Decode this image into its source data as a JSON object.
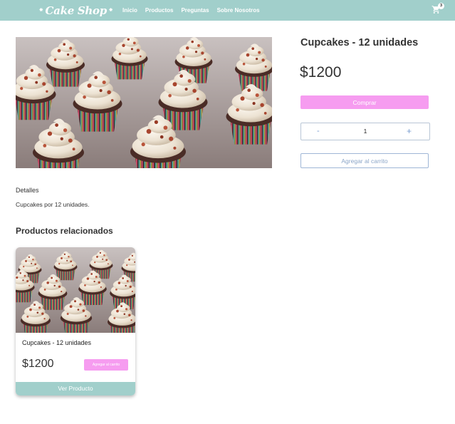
{
  "navbar": {
    "logo_text": "Cake Shop",
    "links": [
      "Inicio",
      "Productos",
      "Preguntas",
      "Sobre Nosotros"
    ],
    "cart_count": "3",
    "background": "#a1cfcb"
  },
  "product": {
    "image_icon": "cupcakes-photo",
    "title": "Cupcakes - 12 unidades",
    "price": "$1200",
    "buy_label": "Comprar",
    "quantity": {
      "minus": "-",
      "value": "1",
      "plus": "+"
    },
    "add_to_cart_label": "Agregar al carrito"
  },
  "details": {
    "title": "Detalles",
    "text": "Cupcakes por 12 unidades."
  },
  "related": {
    "title": "Productos relacionados",
    "items": [
      {
        "image_icon": "cupcakes-photo",
        "title": "Cupcakes - 12 unidades",
        "price": "$1200",
        "add_label": "Agregar al carrito",
        "view_label": "Ver Producto"
      }
    ]
  },
  "colors": {
    "accent_pink": "#f69cf0",
    "teal": "#a1cfcb",
    "outline_blue": "#9fb6d6"
  }
}
